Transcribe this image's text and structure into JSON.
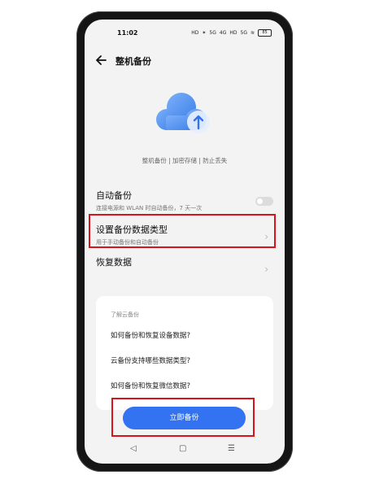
{
  "status_bar": {
    "time": "11:02",
    "icons": [
      "HD",
      "✶",
      "5G",
      "4G",
      "HD",
      "5G",
      "≋"
    ],
    "battery": "85"
  },
  "header": {
    "title": "整机备份"
  },
  "hero": {
    "tagline": "整机备份 | 加密存储 | 防止丢失",
    "icon": "cloud-upload-icon"
  },
  "settings": [
    {
      "title": "自动备份",
      "description": "连接电源和 WLAN 时自动备份，7 天一次",
      "type": "toggle",
      "enabled": false
    },
    {
      "title": "设置备份数据类型",
      "description": "用于手动备份和自动备份",
      "type": "navigation"
    },
    {
      "title": "恢复数据",
      "description": "",
      "type": "navigation"
    }
  ],
  "help": {
    "title": "了解云备份",
    "links": [
      "如何备份和恢复设备数据?",
      "云备份支持哪些数据类型?",
      "如何备份和恢复微信数据?"
    ]
  },
  "actions": {
    "backup_now": "立即备份"
  },
  "navbar": {
    "back": "◁",
    "home": "▢",
    "menu": "☰"
  },
  "colors": {
    "accent": "#3372f0",
    "highlight": "#d8131b",
    "cloud": "#5b9af2"
  }
}
